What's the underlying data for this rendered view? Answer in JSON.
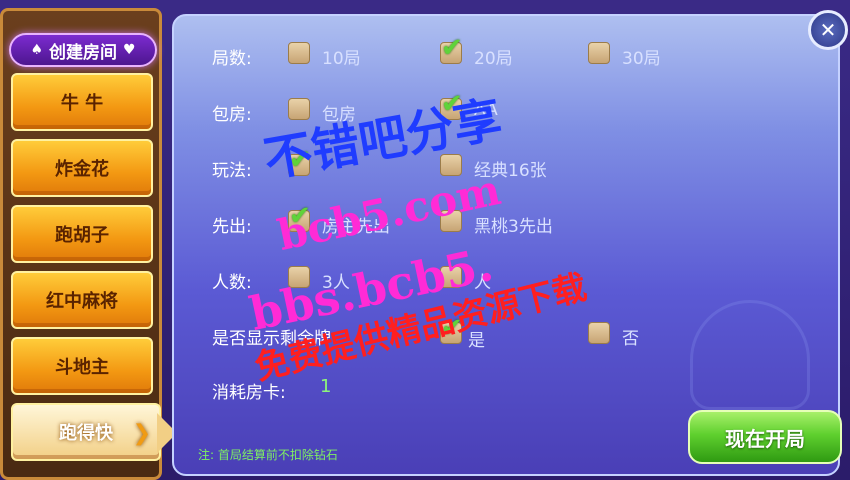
{
  "sidebar": {
    "title": "创建房间",
    "title_suit_left": "♠",
    "title_suit_right": "♥",
    "items": [
      {
        "label": "牛 牛"
      },
      {
        "label": "炸金花"
      },
      {
        "label": "跑胡子"
      },
      {
        "label": "红中麻将"
      },
      {
        "label": "斗地主"
      },
      {
        "label": "跑得快"
      }
    ],
    "active_index": 5
  },
  "close_button": {
    "label": "✕"
  },
  "rows": {
    "rounds": {
      "label": "局数:",
      "options": [
        {
          "text": "10局",
          "checked": false
        },
        {
          "text": "20局",
          "checked": true
        },
        {
          "text": "30局",
          "checked": false
        }
      ]
    },
    "room": {
      "label": "包房:",
      "options": [
        {
          "text": "包房",
          "checked": false
        },
        {
          "text": "AA",
          "checked": true
        }
      ]
    },
    "play": {
      "label": "玩法:",
      "options": [
        {
          "text": "",
          "checked": true
        },
        {
          "text": "经典16张",
          "checked": false
        }
      ]
    },
    "first": {
      "label": "先出:",
      "options": [
        {
          "text": "房主先出",
          "checked": true
        },
        {
          "text": "黑桃3先出",
          "checked": false
        }
      ]
    },
    "players": {
      "label": "人数:",
      "options": [
        {
          "text": "3人",
          "checked": false
        },
        {
          "text": "人",
          "checked": false
        }
      ]
    },
    "show_cards": {
      "label": "是否显示剩余牌",
      "options": [
        {
          "text": "是",
          "checked": true
        },
        {
          "text": "否",
          "checked": false
        }
      ]
    },
    "cost": {
      "label": "消耗房卡:",
      "value": "1"
    }
  },
  "note": "注: 首局结算前不扣除钻石",
  "start_button": {
    "label": "现在开局"
  },
  "check_mark": "✔",
  "watermark": {
    "line1": "不错吧分享",
    "line2": "bcb5.com",
    "line3": "bbs.bcb5.",
    "line4": "免费提供精品资源下载"
  },
  "colors": {
    "accent_green": "#5fd33a",
    "panel_purple": "#5b5ad4",
    "tab_orange": "#f39812"
  }
}
